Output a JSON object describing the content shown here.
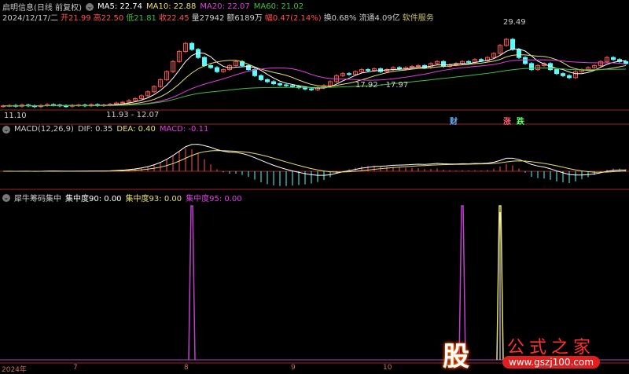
{
  "header": {
    "title": "启明信息(日线 前复权)",
    "ma5": "MA5: 22.74",
    "ma10": "MA10: 22.88",
    "ma20": "MA20: 22.07",
    "ma60": "MA60: 21.02",
    "date": "2024/12/17/二",
    "open": "开21.99",
    "high": "高22.50",
    "low": "低21.81",
    "close": "收22.45",
    "volume": "量27942",
    "amount": "额6189万",
    "change": "幅0.47(2.14%)",
    "turnover": "换0.68%",
    "float": "流通4.09亿",
    "sector": "软件服务"
  },
  "annotations": {
    "max": "29.49",
    "min_left": "11.10",
    "low_mid": "11.93 - 12.07",
    "low_right": "17.92 - 17.97",
    "cai": "财",
    "zhang": "涨",
    "die": "跌"
  },
  "macd": {
    "title": "MACD(12,26,9)",
    "dif": "DIF: 0.35",
    "dea": "DEA: 0.40",
    "macd": "MACD: -0.11"
  },
  "conc": {
    "title": "犀牛筹码集中",
    "c90": "集中度90: 0.00",
    "c93": "集中度93: 0.00",
    "c95": "集中度95: 0.00",
    "spikes_purple": [
      30,
      73
    ],
    "spikes_yellow": [
      79
    ]
  },
  "axis": [
    "2024年",
    "7",
    "8",
    "9",
    "10"
  ],
  "logo": {
    "char": "股",
    "name": "公式之家",
    "url": "www.gszj100.com"
  },
  "colors": {
    "up": "#ff5050",
    "down": "#54ffff",
    "ma5": "#ffffff",
    "ma10": "#e8e070",
    "ma20": "#e040e0",
    "ma60": "#40c040"
  },
  "chart_data": {
    "type": "candlestick",
    "ylim": [
      10,
      33
    ],
    "closes": [
      12.0,
      12.1,
      11.9,
      12.2,
      12.0,
      11.8,
      12.1,
      12.3,
      12.2,
      12.0,
      11.9,
      12.1,
      12.2,
      12.0,
      12.3,
      12.1,
      12.2,
      12.4,
      12.7,
      12.9,
      13.3,
      13.8,
      14.5,
      15.5,
      16.8,
      18.5,
      20.5,
      23.0,
      25.5,
      27.5,
      26.0,
      24.0,
      22.0,
      21.5,
      20.5,
      21.0,
      22.0,
      23.0,
      22.0,
      21.0,
      19.5,
      18.5,
      18.0,
      17.5,
      17.2,
      17.0,
      16.8,
      16.5,
      16.2,
      16.0,
      16.5,
      17.0,
      18.0,
      19.5,
      20.0,
      19.8,
      20.5,
      21.0,
      20.8,
      21.2,
      20.5,
      21.0,
      21.5,
      21.2,
      21.5,
      21.8,
      22.0,
      21.5,
      22.5,
      23.0,
      21.8,
      22.2,
      22.5,
      23.0,
      22.8,
      23.5,
      23.2,
      24.0,
      25.0,
      27.0,
      28.5,
      26.0,
      24.0,
      22.5,
      21.0,
      22.0,
      22.5,
      21.0,
      20.0,
      19.5,
      19.0,
      20.5,
      21.0,
      21.5,
      22.0,
      23.0,
      24.0,
      23.5,
      23.0,
      22.5
    ]
  }
}
